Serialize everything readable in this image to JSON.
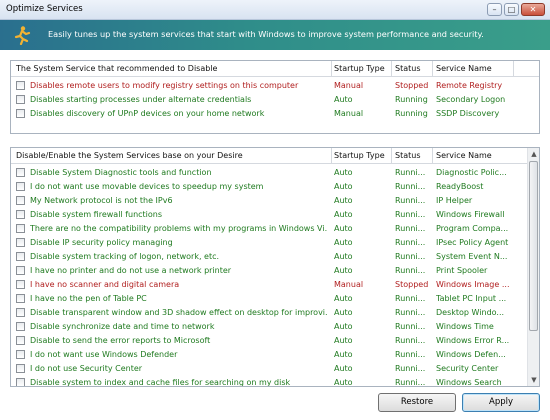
{
  "window": {
    "title": "Optimize Services",
    "min_glyph": "–",
    "max_glyph": "□",
    "close_glyph": "✕"
  },
  "banner": {
    "text": "Easily tunes up the system services that start with Windows to improve system performance and security.",
    "logo_icon": "running-figure-icon"
  },
  "recommended": {
    "columns": [
      "The System Service that recommended to Disable",
      "Startup Type",
      "Status",
      "Service Name"
    ],
    "rows": [
      {
        "desc": "Disables remote users to modify registry settings on this computer",
        "startup": "Manual",
        "status": "Stopped",
        "name": "Remote Registry",
        "color": "red"
      },
      {
        "desc": "Disables starting processes under alternate credentials",
        "startup": "Auto",
        "status": "Running",
        "name": "Secondary Logon",
        "color": "green"
      },
      {
        "desc": "Disables discovery of UPnP devices on your home network",
        "startup": "Manual",
        "status": "Running",
        "name": "SSDP Discovery",
        "color": "green"
      }
    ]
  },
  "services": {
    "columns": [
      "Disable/Enable the System Services base on your Desire",
      "Startup Type",
      "Status",
      "Service Name"
    ],
    "rows": [
      {
        "desc": "Disable System Diagnostic tools and function",
        "startup": "Auto",
        "status": "Runni...",
        "name": "Diagnostic Polic...",
        "color": "green"
      },
      {
        "desc": "I do not want use movable devices to speedup my system",
        "startup": "Auto",
        "status": "Runni...",
        "name": "ReadyBoost",
        "color": "green"
      },
      {
        "desc": "My Network protocol is not the IPv6",
        "startup": "Auto",
        "status": "Runni...",
        "name": "IP Helper",
        "color": "green"
      },
      {
        "desc": "Disable system firewall functions",
        "startup": "Auto",
        "status": "Runni...",
        "name": "Windows Firewall",
        "color": "green"
      },
      {
        "desc": "There are no the compatibility problems with my programs in Windows Vi...",
        "startup": "Auto",
        "status": "Runni...",
        "name": "Program Compa...",
        "color": "green"
      },
      {
        "desc": "Disable IP security policy managing",
        "startup": "Auto",
        "status": "Runni...",
        "name": "IPsec Policy Agent",
        "color": "green"
      },
      {
        "desc": "Disable system tracking of logon, network, etc.",
        "startup": "Auto",
        "status": "Runni...",
        "name": "System Event N...",
        "color": "green"
      },
      {
        "desc": "I have no printer and do not use a network printer",
        "startup": "Auto",
        "status": "Runni...",
        "name": "Print Spooler",
        "color": "green"
      },
      {
        "desc": "I have no scanner and digital camera",
        "startup": "Manual",
        "status": "Stopped",
        "name": "Windows Image ...",
        "color": "red"
      },
      {
        "desc": "I have no the pen of Table PC",
        "startup": "Auto",
        "status": "Runni...",
        "name": "Tablet PC Input ...",
        "color": "green"
      },
      {
        "desc": "Disable transparent window and 3D shadow effect on desktop for improvi...",
        "startup": "Auto",
        "status": "Runni...",
        "name": "Desktop Windo...",
        "color": "green"
      },
      {
        "desc": "Disable synchronize date and time to network",
        "startup": "Auto",
        "status": "Runni...",
        "name": "Windows Time",
        "color": "green"
      },
      {
        "desc": "Disable to send the error reports to Microsoft",
        "startup": "Auto",
        "status": "Runni...",
        "name": "Windows Error R...",
        "color": "green"
      },
      {
        "desc": "I do not want use Windows Defender",
        "startup": "Auto",
        "status": "Runni...",
        "name": "Windows Defen...",
        "color": "green"
      },
      {
        "desc": "I do not use Security Center",
        "startup": "Auto",
        "status": "Runni...",
        "name": "Security Center",
        "color": "green"
      },
      {
        "desc": "Disable system to index and cache files for searching on my disk",
        "startup": "Auto",
        "status": "Runni...",
        "name": "Windows Search",
        "color": "green"
      }
    ]
  },
  "buttons": {
    "restore": "Restore",
    "apply": "Apply"
  },
  "scroll": {
    "up_glyph": "▲",
    "down_glyph": "▼"
  }
}
